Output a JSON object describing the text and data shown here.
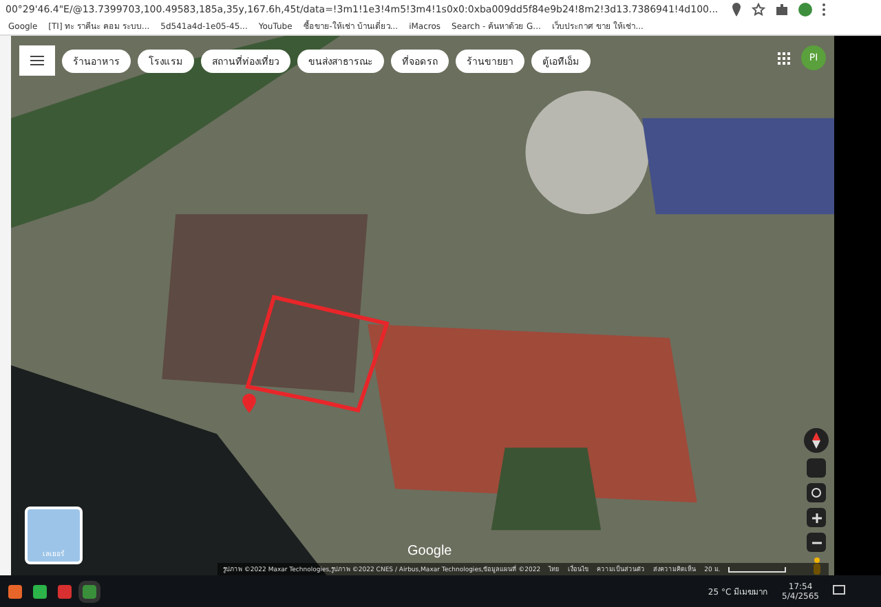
{
  "browser": {
    "url": "00°29'46.4\"E/@13.7399703,100.49583,185a,35y,167.6h,45t/data=!3m1!1e3!4m5!3m4!1s0x0:0xba009dd5f84e9b24!8m2!3d13.7386941!4d100...",
    "bookmarks": [
      {
        "label": "Google"
      },
      {
        "label": "[TI] ทะ ราคีนะ คอม ระบบ..."
      },
      {
        "label": "5d541a4d-1e05-45..."
      },
      {
        "label": "YouTube"
      },
      {
        "label": "ซื้อขาย-ให้เช่า บ้านเดี่ยว..."
      },
      {
        "label": "iMacros"
      },
      {
        "label": "Search - ค้นหาด้วย G..."
      },
      {
        "label": "เว็บประกาศ ขาย ให้เช่า..."
      }
    ]
  },
  "map": {
    "chips": [
      {
        "label": "ร้านอาหาร"
      },
      {
        "label": "โรงแรม"
      },
      {
        "label": "สถานที่ท่องเที่ยว"
      },
      {
        "label": "ขนส่งสาธารณะ"
      },
      {
        "label": "ที่จอดรถ"
      },
      {
        "label": "ร้านขายยา"
      },
      {
        "label": "ตู้เอทีเอ็ม"
      }
    ],
    "account_initials": "PI",
    "logo": "Google",
    "attribution": "รูปภาพ ©2022 Maxar Technologies,รูปภาพ ©2022 CNES / Airbus,Maxar Technologies,ข้อมูลแผนที่ ©2022",
    "footer_links": [
      "ไทย",
      "เงื่อนไข",
      "ความเป็นส่วนตัว",
      "ส่งความคิดเห็น"
    ],
    "scale": "20 ม.",
    "layer_label": "เลเยอร์"
  },
  "taskbar": {
    "weather": "25 °C มีเมฆมาก",
    "time": "17:54",
    "date": "5/4/2565"
  }
}
